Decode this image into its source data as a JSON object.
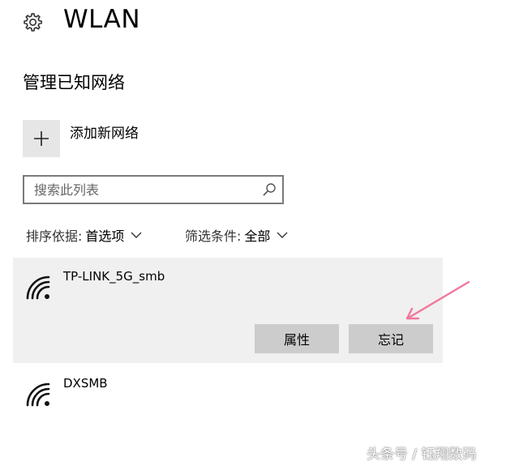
{
  "header": {
    "icon": "gear-icon",
    "title": "WLAN"
  },
  "section": {
    "title": "管理已知网络"
  },
  "add_network": {
    "icon": "plus-icon",
    "label": "添加新网络"
  },
  "search": {
    "placeholder": "搜索此列表",
    "value": "",
    "icon": "search-icon"
  },
  "filters": {
    "sort": {
      "label": "排序依据:",
      "value": "首选项",
      "icon": "chevron-down-icon"
    },
    "filter": {
      "label": "筛选条件:",
      "value": "全部",
      "icon": "chevron-down-icon"
    }
  },
  "networks": [
    {
      "name": "TP-LINK_5G_smb",
      "icon": "wifi-icon",
      "selected": true,
      "buttons": {
        "properties": "属性",
        "forget": "忘记"
      }
    },
    {
      "name": "DXSMB",
      "icon": "wifi-icon",
      "selected": false
    }
  ],
  "annotation": {
    "color": "#f0789c"
  },
  "watermark": "头条号 / 钰翔数码",
  "colors": {
    "selected_bg": "#f0f0f0",
    "button_bg": "#cccccc",
    "add_button_bg": "#e6e6e6",
    "search_border": "#7a7a7a"
  }
}
